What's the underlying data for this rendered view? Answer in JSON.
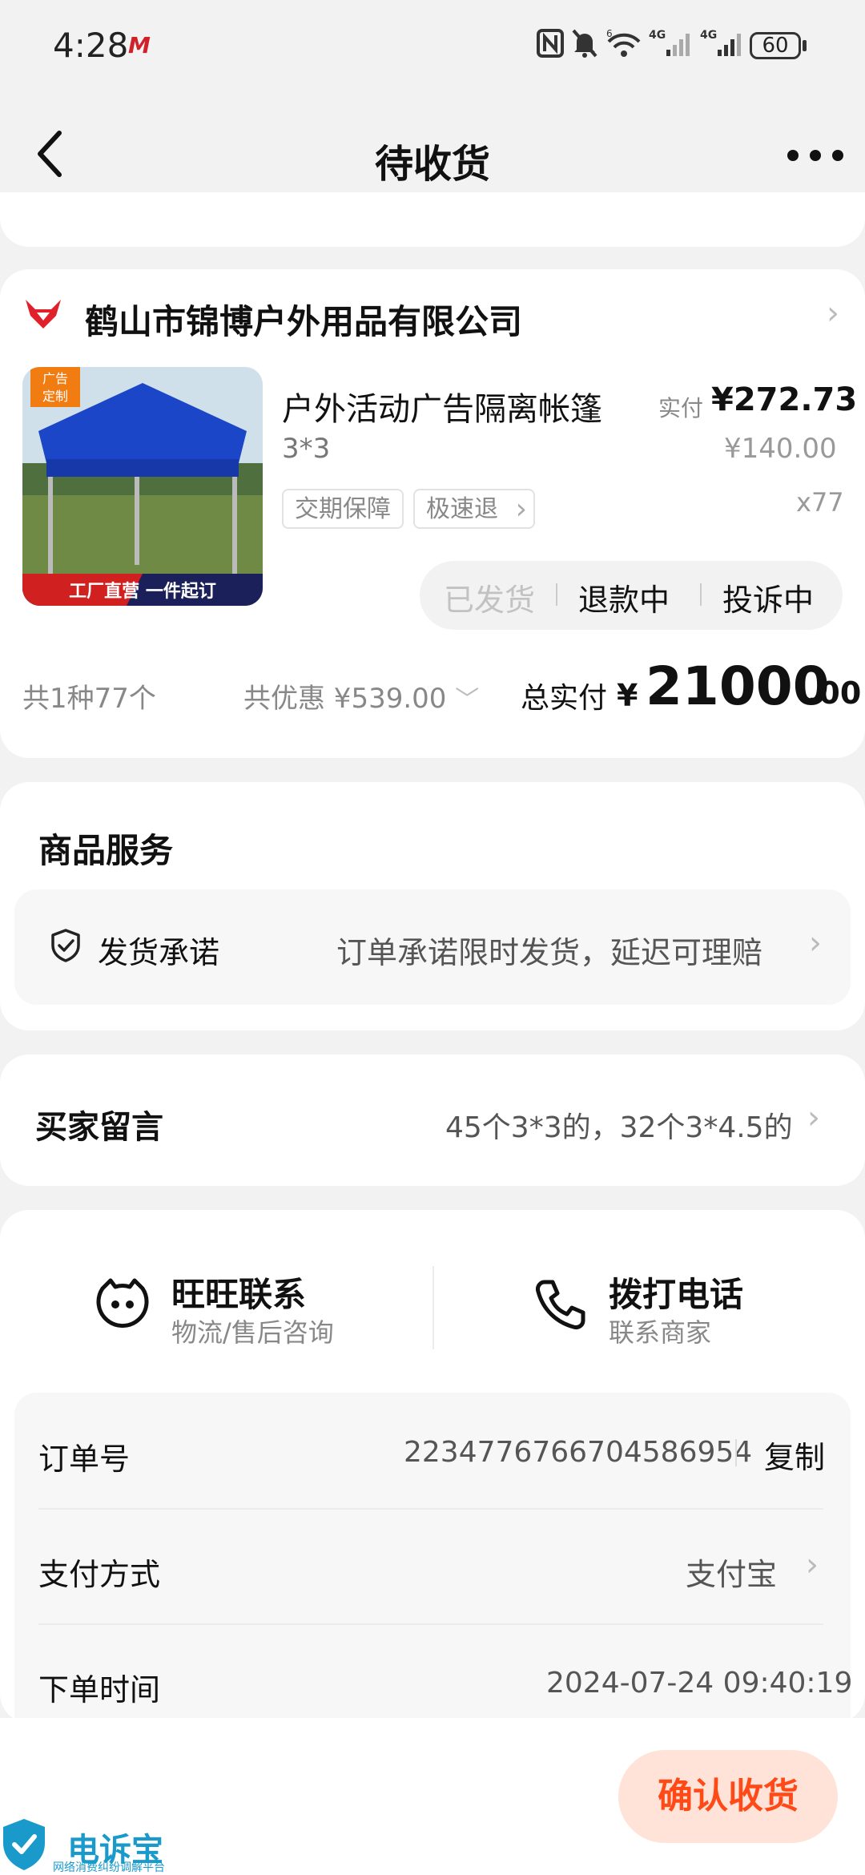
{
  "status_bar": {
    "time": "4:28",
    "carrier_mark": "M",
    "battery": "60",
    "icons": [
      "nfc-icon",
      "mute-icon",
      "wifi-icon",
      "signal-4g-icon",
      "signal-4g-icon"
    ]
  },
  "nav": {
    "title": "待收货",
    "back_icon": "chevron-left-icon",
    "more_icon": "more-icon"
  },
  "order": {
    "shop_name": "鹤山市锦博户外用品有限公司",
    "product": {
      "title": "户外活动广告隔离帐篷",
      "spec": "3*3",
      "tags": [
        "交期保障",
        "极速退"
      ],
      "paid_label": "实付",
      "paid_value": "¥272.73",
      "original_price": "¥140.00",
      "quantity": "x77",
      "image_labels": {
        "badge": "广告定制",
        "banner": "工厂直营 一件起订"
      }
    },
    "status_tabs": [
      "已发货",
      "退款中",
      "投诉中"
    ],
    "summary": {
      "count": "共1种77个",
      "discount": "共优惠 ¥539.00",
      "total_label": "总实付",
      "total_yen": "¥",
      "total_int": "21000",
      "total_dec": ".00"
    }
  },
  "service": {
    "title": "商品服务",
    "item_label": "发货承诺",
    "item_desc": "订单承诺限时发货，延迟可理赔"
  },
  "buyer_message": {
    "label": "买家留言",
    "value": "45个3*3的，32个3*4.5的"
  },
  "contact": {
    "wangwang_title": "旺旺联系",
    "wangwang_sub": "物流/售后咨询",
    "phone_title": "拨打电话",
    "phone_sub": "联系商家"
  },
  "info": {
    "order_no_label": "订单号",
    "order_no": "2234776766704586954",
    "copy_label": "复制",
    "payment_label": "支付方式",
    "payment_value": "支付宝",
    "time_label": "下单时间",
    "time_value": "2024-07-24 09:40:19"
  },
  "actions": {
    "confirm": "确认收货"
  },
  "watermark": {
    "text": "电诉宝",
    "sub": "网络消费纠纷调解平台"
  },
  "colors": {
    "accent": "#ff4a17",
    "confirm_bg": "#ffe3d8",
    "shop_logo": "#e0202a",
    "watermark": "#1a9acb"
  }
}
